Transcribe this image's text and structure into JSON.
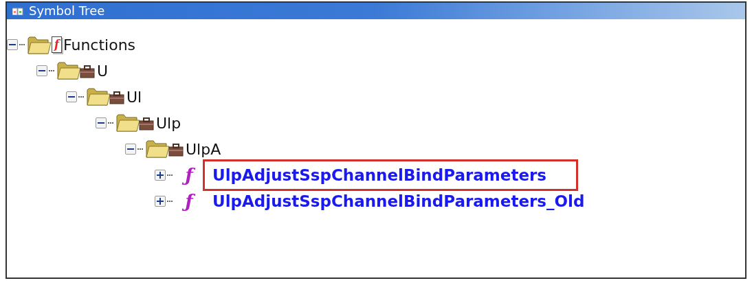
{
  "window": {
    "title": "Symbol Tree"
  },
  "tree": [
    {
      "kind": "category",
      "icon": "f",
      "label": "Functions",
      "expanded": true,
      "highlighted": false,
      "children": [
        {
          "kind": "folder",
          "label": "U",
          "expanded": true,
          "highlighted": false,
          "children": [
            {
              "kind": "folder",
              "label": "Ul",
              "expanded": true,
              "highlighted": false,
              "children": [
                {
                  "kind": "folder",
                  "label": "Ulp",
                  "expanded": true,
                  "highlighted": false,
                  "children": [
                    {
                      "kind": "folder",
                      "label": "UlpA",
                      "expanded": true,
                      "highlighted": false,
                      "children": [
                        {
                          "kind": "function",
                          "icon": "ƒ",
                          "label": "UlpAdjustSspChannelBindParameters",
                          "expanded": false,
                          "highlighted": true
                        },
                        {
                          "kind": "function",
                          "icon": "ƒ",
                          "label": "UlpAdjustSspChannelBindParameters_Old",
                          "expanded": false,
                          "highlighted": false
                        }
                      ]
                    }
                  ]
                }
              ]
            }
          ]
        }
      ]
    }
  ]
}
